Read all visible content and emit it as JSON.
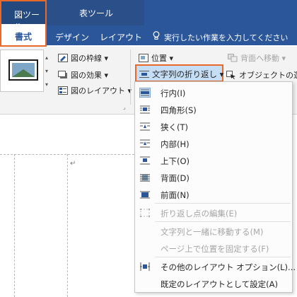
{
  "context_tabs": {
    "picture_tools": "図ツール",
    "table_tools": "表ツール"
  },
  "tabs": {
    "format": "書式",
    "design": "デザイン",
    "layout": "レイアウト"
  },
  "tell_me": "実行したい作業を入力してください",
  "ribbon": {
    "picture_border": "図の枠線",
    "picture_effects": "図の効果",
    "picture_layout": "図のレイアウト",
    "position": "位置",
    "send_backward": "背面へ移動",
    "wrap_text": "文字列の折り返し",
    "selection_pane": "オブジェクトの選択"
  },
  "wrap_menu": {
    "items": [
      {
        "label": "行内(I)",
        "icon": "inline-icon",
        "checked": true,
        "disabled": false
      },
      {
        "label": "四角形(S)",
        "icon": "square-wrap-icon",
        "checked": false,
        "disabled": false
      },
      {
        "label": "狭く(T)",
        "icon": "tight-wrap-icon",
        "checked": false,
        "disabled": false
      },
      {
        "label": "内部(H)",
        "icon": "through-wrap-icon",
        "checked": false,
        "disabled": false
      },
      {
        "label": "上下(O)",
        "icon": "top-bottom-wrap-icon",
        "checked": false,
        "disabled": false
      },
      {
        "label": "背面(D)",
        "icon": "behind-text-icon",
        "checked": false,
        "disabled": false
      },
      {
        "label": "前面(N)",
        "icon": "in-front-text-icon",
        "checked": false,
        "disabled": false
      },
      {
        "label": "折り返し点の編集(E)",
        "icon": "edit-wrap-points-icon",
        "checked": false,
        "disabled": true
      },
      {
        "label": "文字列と一緒に移動する(M)",
        "icon": "",
        "checked": false,
        "disabled": true
      },
      {
        "label": "ページ上で位置を固定する(F)",
        "icon": "",
        "checked": false,
        "disabled": true
      },
      {
        "label": "その他のレイアウト オプション(L)...",
        "icon": "more-layout-options-icon",
        "checked": false,
        "disabled": false
      },
      {
        "label": "既定のレイアウトとして設定(A)",
        "icon": "",
        "checked": false,
        "disabled": false
      }
    ]
  },
  "colors": {
    "title_bar": "#2b579a",
    "highlight_outline": "#e8692a",
    "selected_fill": "#c5def5"
  }
}
